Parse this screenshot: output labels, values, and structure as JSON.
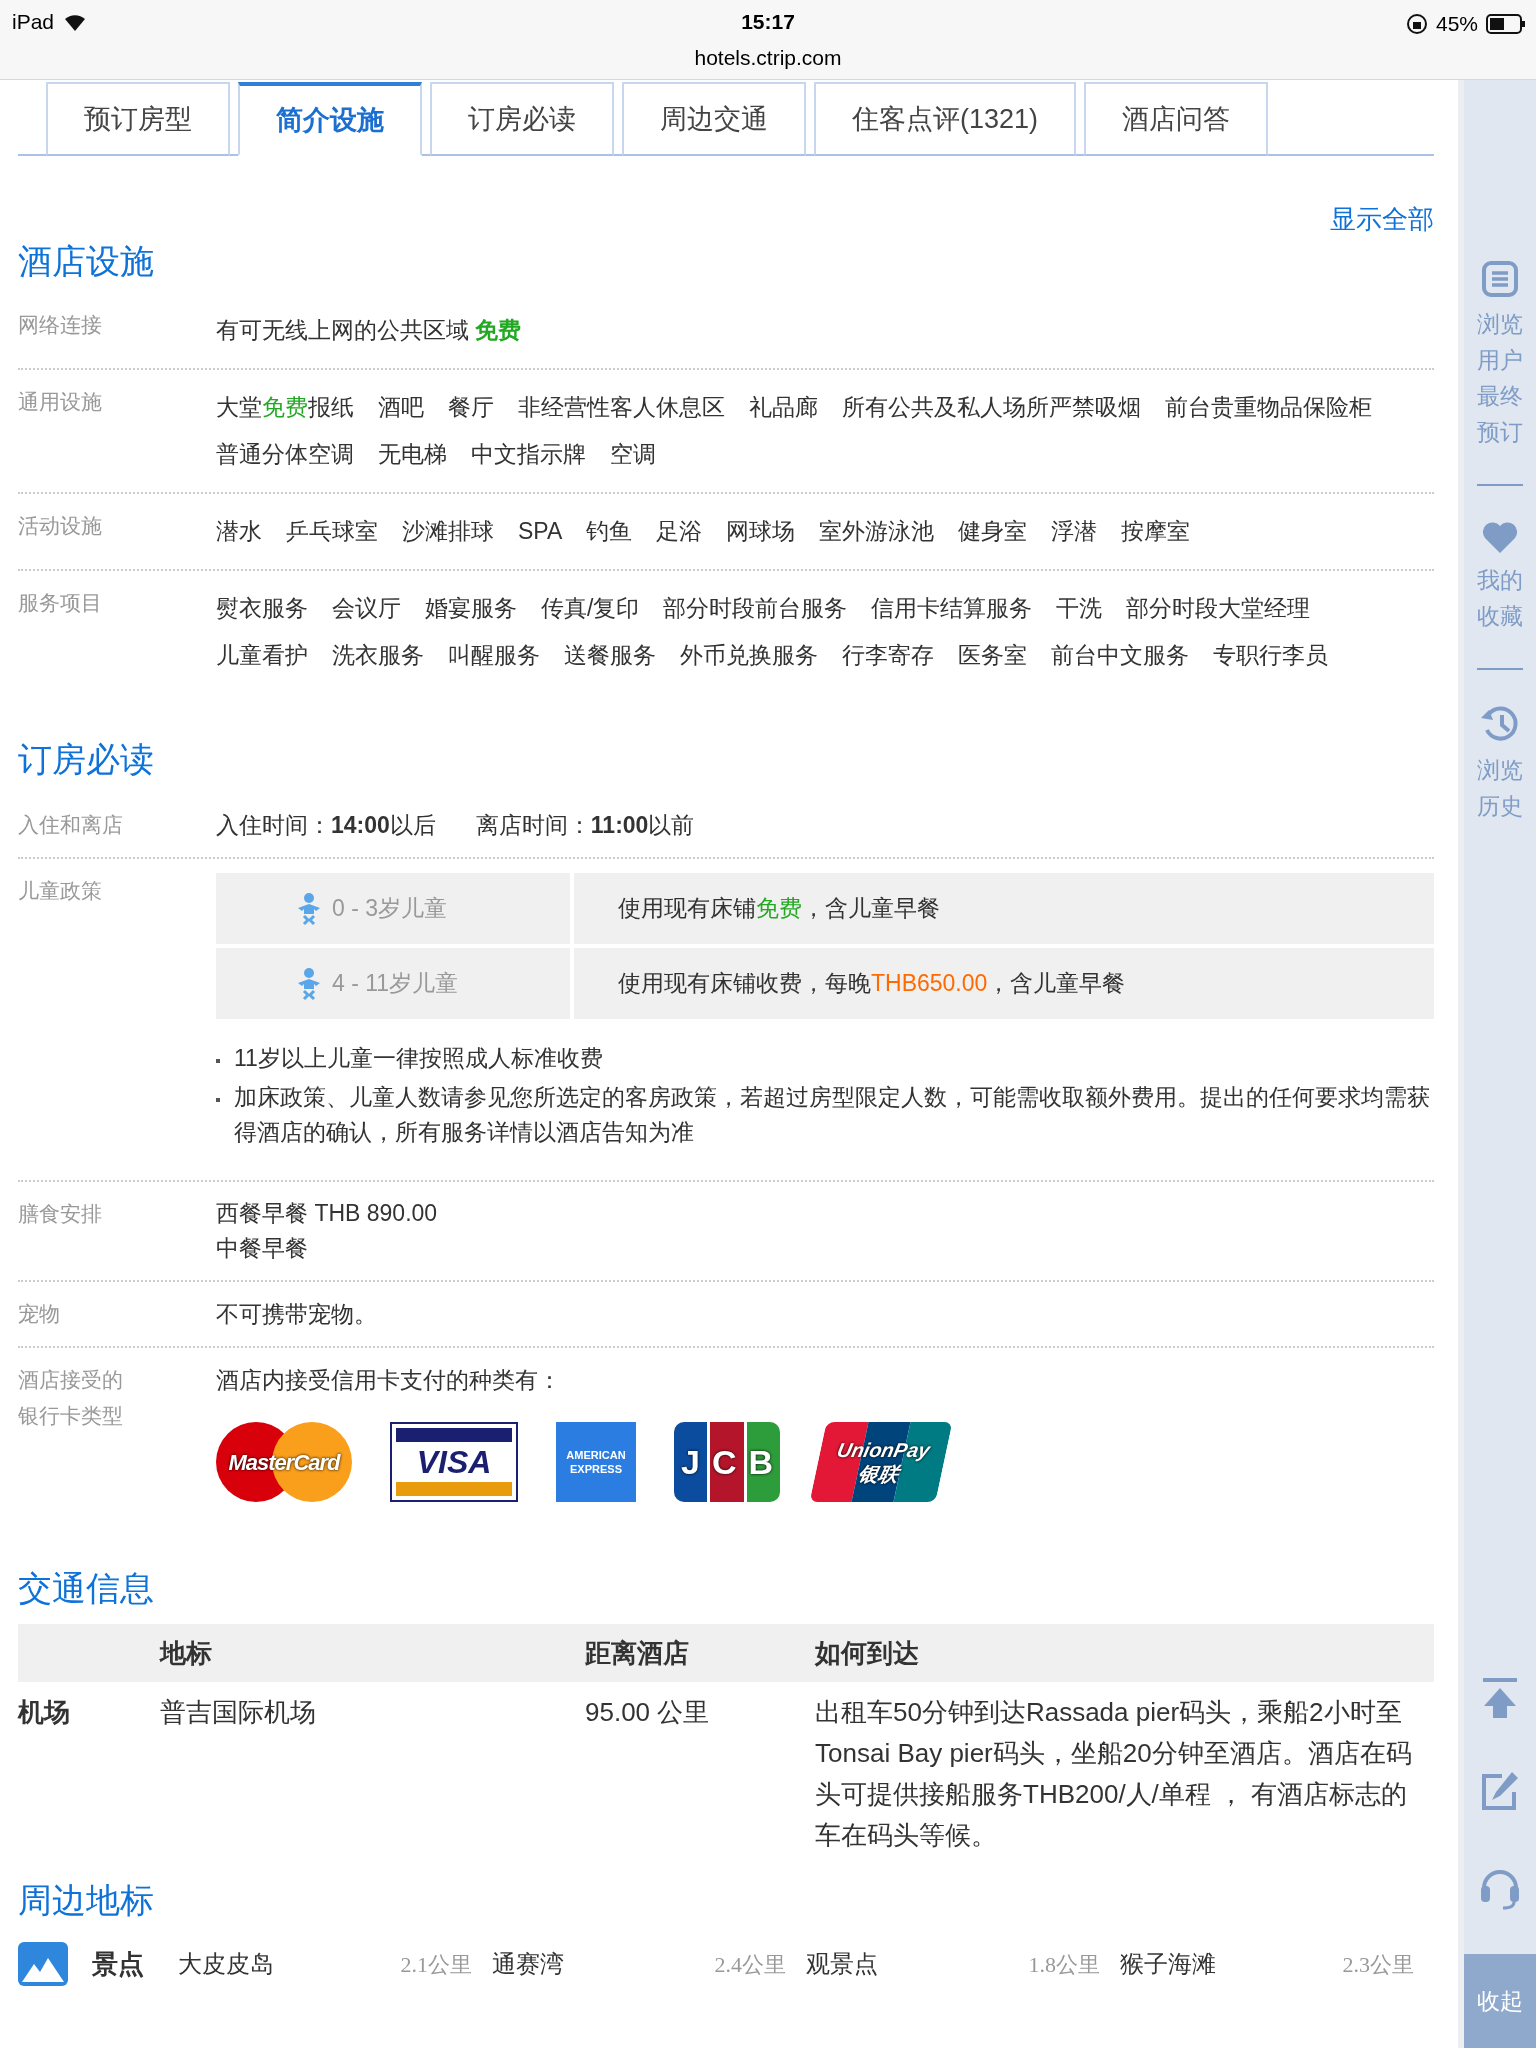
{
  "status_bar": {
    "device": "iPad",
    "time": "15:17",
    "url": "hotels.ctrip.com",
    "battery": "45%"
  },
  "tabs": [
    {
      "label": "预订房型",
      "selected": false
    },
    {
      "label": "简介设施",
      "selected": true
    },
    {
      "label": "订房必读",
      "selected": false
    },
    {
      "label": "周边交通",
      "selected": false
    },
    {
      "label": "住客点评(1321)",
      "selected": false
    },
    {
      "label": "酒店问答",
      "selected": false
    }
  ],
  "show_all": "显示全部",
  "facilities": {
    "title": "酒店设施",
    "rows": [
      {
        "label": "网络连接",
        "lines": [
          [
            {
              "segments": [
                {
                  "text": "有可无线上网的公共区域 "
                },
                {
                  "text": "免费",
                  "kind": "free",
                  "bold": true
                }
              ]
            }
          ]
        ]
      },
      {
        "label": "通用设施",
        "lines": [
          [
            {
              "segments": [
                {
                  "text": "大堂"
                },
                {
                  "text": "免费",
                  "kind": "free"
                },
                {
                  "text": "报纸"
                }
              ]
            },
            {
              "segments": [
                {
                  "text": "酒吧"
                }
              ]
            },
            {
              "segments": [
                {
                  "text": "餐厅"
                }
              ]
            },
            {
              "segments": [
                {
                  "text": "非经营性客人休息区"
                }
              ]
            },
            {
              "segments": [
                {
                  "text": "礼品廊"
                }
              ]
            },
            {
              "segments": [
                {
                  "text": "所有公共及私人场所严禁吸烟"
                }
              ]
            },
            {
              "segments": [
                {
                  "text": "前台贵重物品保险柜"
                }
              ]
            }
          ],
          [
            {
              "segments": [
                {
                  "text": "普通分体空调"
                }
              ]
            },
            {
              "segments": [
                {
                  "text": "无电梯"
                }
              ]
            },
            {
              "segments": [
                {
                  "text": "中文指示牌"
                }
              ]
            },
            {
              "segments": [
                {
                  "text": "空调"
                }
              ]
            }
          ]
        ]
      },
      {
        "label": "活动设施",
        "lines": [
          [
            {
              "segments": [
                {
                  "text": "潜水"
                }
              ]
            },
            {
              "segments": [
                {
                  "text": "乒乓球室"
                }
              ]
            },
            {
              "segments": [
                {
                  "text": "沙滩排球"
                }
              ]
            },
            {
              "segments": [
                {
                  "text": "SPA"
                }
              ]
            },
            {
              "segments": [
                {
                  "text": "钓鱼"
                }
              ]
            },
            {
              "segments": [
                {
                  "text": "足浴"
                }
              ]
            },
            {
              "segments": [
                {
                  "text": "网球场"
                }
              ]
            },
            {
              "segments": [
                {
                  "text": "室外游泳池"
                }
              ]
            },
            {
              "segments": [
                {
                  "text": "健身室"
                }
              ]
            },
            {
              "segments": [
                {
                  "text": "浮潜"
                }
              ]
            },
            {
              "segments": [
                {
                  "text": "按摩室"
                }
              ]
            }
          ]
        ]
      },
      {
        "label": "服务项目",
        "lines": [
          [
            {
              "segments": [
                {
                  "text": "熨衣服务"
                }
              ]
            },
            {
              "segments": [
                {
                  "text": "会议厅"
                }
              ]
            },
            {
              "segments": [
                {
                  "text": "婚宴服务"
                }
              ]
            },
            {
              "segments": [
                {
                  "text": "传真/复印"
                }
              ]
            },
            {
              "segments": [
                {
                  "text": "部分时段前台服务"
                }
              ]
            },
            {
              "segments": [
                {
                  "text": "信用卡结算服务"
                }
              ]
            },
            {
              "segments": [
                {
                  "text": "干洗"
                }
              ]
            },
            {
              "segments": [
                {
                  "text": "部分时段大堂经理"
                }
              ]
            }
          ],
          [
            {
              "segments": [
                {
                  "text": "儿童看护"
                }
              ]
            },
            {
              "segments": [
                {
                  "text": "洗衣服务"
                }
              ]
            },
            {
              "segments": [
                {
                  "text": "叫醒服务"
                }
              ]
            },
            {
              "segments": [
                {
                  "text": "送餐服务"
                }
              ]
            },
            {
              "segments": [
                {
                  "text": "外币兑换服务"
                }
              ]
            },
            {
              "segments": [
                {
                  "text": "行李寄存"
                }
              ]
            },
            {
              "segments": [
                {
                  "text": "医务室"
                }
              ]
            },
            {
              "segments": [
                {
                  "text": "前台中文服务"
                }
              ]
            },
            {
              "segments": [
                {
                  "text": "专职行李员"
                }
              ]
            }
          ]
        ]
      }
    ]
  },
  "policies": {
    "title": "订房必读",
    "checkin": {
      "label": "入住和离店",
      "checkin": "入住时间：**14:00**以后",
      "checkout": "离店时间：**11:00**以前"
    },
    "children": {
      "label": "儿童政策",
      "rows": [
        {
          "age": "0 - 3岁儿童",
          "segments": [
            {
              "text": "使用现有床铺"
            },
            {
              "text": "免费",
              "kind": "free"
            },
            {
              "text": "，含儿童早餐"
            }
          ]
        },
        {
          "age": "4 - 11岁儿童",
          "segments": [
            {
              "text": "使用现有床铺收费，每晚"
            },
            {
              "text": "THB650.00",
              "kind": "price"
            },
            {
              "text": "，含儿童早餐"
            }
          ]
        }
      ],
      "notes": [
        "11岁以上儿童一律按照成人标准收费",
        "加床政策、儿童人数请参见您所选定的客房政策，若超过房型限定人数，可能需收取额外费用。提出的任何要求均需获得酒店的确认，所有服务详情以酒店告知为准"
      ]
    },
    "meals": {
      "label": "膳食安排",
      "lines": [
        "西餐早餐 THB 890.00",
        "中餐早餐"
      ]
    },
    "pets": {
      "label": "宠物",
      "text": "不可携带宠物。"
    },
    "cards": {
      "label": "酒店接受的银行卡类型",
      "intro": "酒店内接受信用卡支付的种类有：",
      "logos": [
        {
          "kind": "mastercard",
          "text": "MasterCard"
        },
        {
          "kind": "visa",
          "text": "VISA"
        },
        {
          "kind": "amex",
          "text": "AMERICAN EXPRESS"
        },
        {
          "kind": "jcb",
          "text": "JCB"
        },
        {
          "kind": "unionpay",
          "text": "UnionPay",
          "sub": "银联"
        }
      ]
    }
  },
  "transport": {
    "title": "交通信息",
    "columns": [
      "地标",
      "距离酒店",
      "如何到达"
    ],
    "rows": [
      {
        "type": "机场",
        "name": "普吉国际机场",
        "distance": "95.00 公里",
        "how": "出租车50分钟到达Rassada pier码头，乘船2小时至Tonsai Bay pier码头，坐船20分钟至酒店。酒店在码头可提供接船服务THB200/人/单程 ， 有酒店标志的车在码头等候。"
      }
    ]
  },
  "landmarks": {
    "title": "周边地标",
    "category": "景点",
    "items": [
      {
        "name": "大皮皮岛",
        "distance": "2.1公里"
      },
      {
        "name": "通赛湾",
        "distance": "2.4公里"
      },
      {
        "name": "观景点",
        "distance": "1.8公里"
      },
      {
        "name": "猴子海滩",
        "distance": "2.3公里"
      }
    ]
  },
  "sidebar": {
    "items": [
      {
        "kind": "list",
        "label": "浏览用户最终预订"
      },
      {
        "kind": "heart",
        "label": "我的收藏"
      },
      {
        "kind": "history",
        "label": "浏览历史"
      }
    ],
    "collapse": "收起"
  }
}
